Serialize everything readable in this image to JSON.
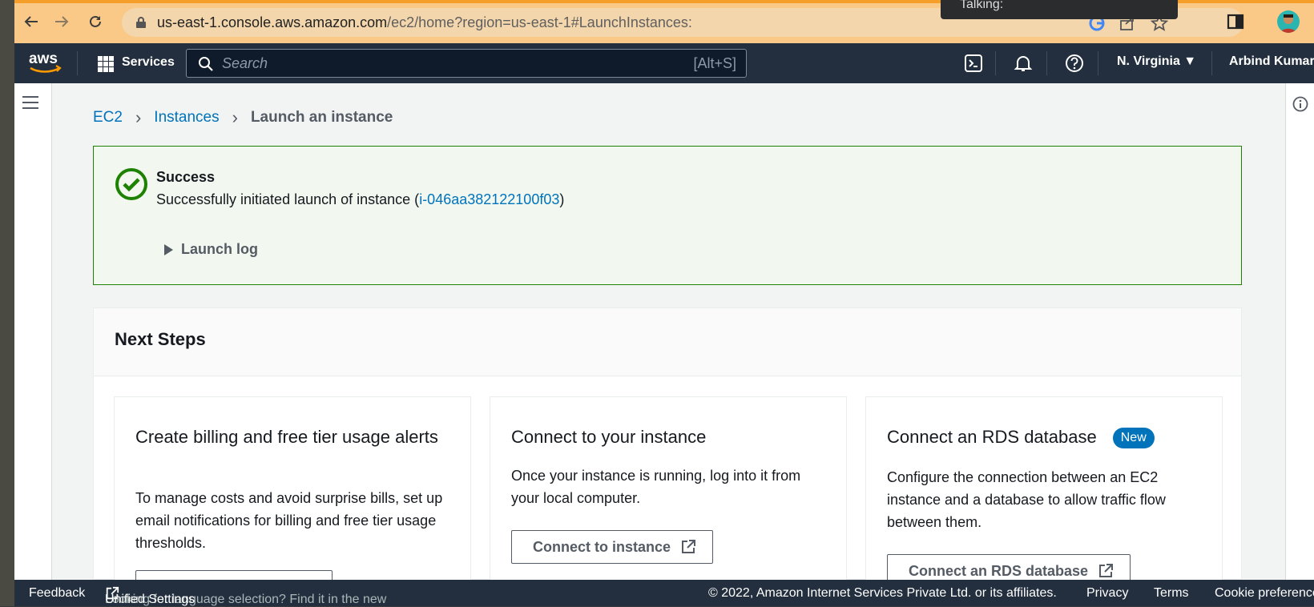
{
  "browser": {
    "url_host": "us-east-1.console.aws.amazon.com",
    "url_path": "/ec2/home?region=us-east-1#LaunchInstances:",
    "tooltip_text": "Talking:"
  },
  "header": {
    "logo_text": "aws",
    "services_label": "Services",
    "search_placeholder": "Search",
    "search_shortcut": "[Alt+S]",
    "region_label": "N. Virginia",
    "user_label": "Arbind Kumar"
  },
  "breadcrumb": {
    "items": [
      "EC2",
      "Instances",
      "Launch an instance"
    ]
  },
  "flash": {
    "title": "Success",
    "message_prefix": "Successfully initiated launch of instance (",
    "instance_id": "i-046aa382122100f03",
    "message_suffix": ")",
    "launch_log_label": "Launch log"
  },
  "next_steps": {
    "title": "Next Steps",
    "cards": [
      {
        "title": "Create billing and free tier usage alerts",
        "body": "To manage costs and avoid surprise bills, set up email notifications for billing and free tier usage thresholds.",
        "button": ""
      },
      {
        "title": "Connect to your instance",
        "body": "Once your instance is running, log into it from your local computer.",
        "button": "Connect to instance"
      },
      {
        "title": "Connect an RDS database",
        "badge": "New",
        "body": "Configure the connection between an EC2 instance and a database to allow traffic flow between them.",
        "button": "Connect an RDS database"
      }
    ]
  },
  "footer": {
    "feedback": "Feedback",
    "language_prompt": "Looking for language selection? Find it in the new",
    "unified_settings": "Unified Settings",
    "copyright": "© 2022, Amazon Internet Services Private Ltd. or its affiliates.",
    "privacy": "Privacy",
    "terms": "Terms",
    "cookie": "Cookie preference"
  },
  "colors": {
    "aws_header": "#232f3e",
    "link": "#0073bb",
    "success": "#1d8102",
    "chrome_frame": "#fbc987"
  }
}
